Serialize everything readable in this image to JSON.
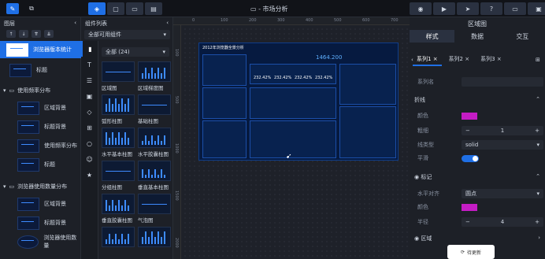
{
  "app": {
    "title": "市场分析",
    "title_icon": "monitor-icon"
  },
  "layers": {
    "header": "图层",
    "items": [
      {
        "label": "浏览器版本统计",
        "selected": true
      },
      {
        "label": "标题"
      }
    ],
    "groups": [
      {
        "label": "使用频率分布",
        "children": [
          "区域背景",
          "标题背景",
          "使用频率分布",
          "标题"
        ]
      },
      {
        "label": "浏览器使用数量分布",
        "children": [
          "区域背景",
          "标题背景",
          "浏览器使用数量"
        ]
      }
    ]
  },
  "components": {
    "header": "组件列表",
    "filter": "全部可用组件",
    "all_label": "全部 (24)",
    "items": [
      "区域图",
      "区域梯度图",
      "弧形柱图",
      "基础柱图",
      "水平基本柱图",
      "水平胶囊柱图",
      "分组柱图",
      "垂直基本柱图",
      "垂直胶囊柱图",
      "气泡图",
      "",
      ""
    ]
  },
  "dashboard": {
    "title": "2012年浏览器全景分析",
    "number": "1464.200",
    "stats": [
      "232.42%",
      "232.42%",
      "232.42%",
      "232.42%"
    ]
  },
  "props": {
    "header": "区域图",
    "tabs": [
      "样式",
      "数据",
      "交互"
    ],
    "series": [
      "系列1",
      "系列2",
      "系列3"
    ],
    "series_name_label": "系列名",
    "section_line": "折线",
    "color_label": "颜色",
    "width_label": "粗细",
    "width_value": "1",
    "linetype_label": "线类型",
    "linetype_value": "solid",
    "smooth_label": "平滑",
    "section_marker": "标记",
    "shape_label": "水平对齐",
    "shape_value": "圆点",
    "marker_color_label": "颜色",
    "radius_label": "半径",
    "radius_value": "4",
    "section_area": "区域"
  },
  "toast": {
    "text": "待更新"
  },
  "colors": {
    "accent": "#1f6fe5",
    "magenta": "#c41cc4"
  }
}
